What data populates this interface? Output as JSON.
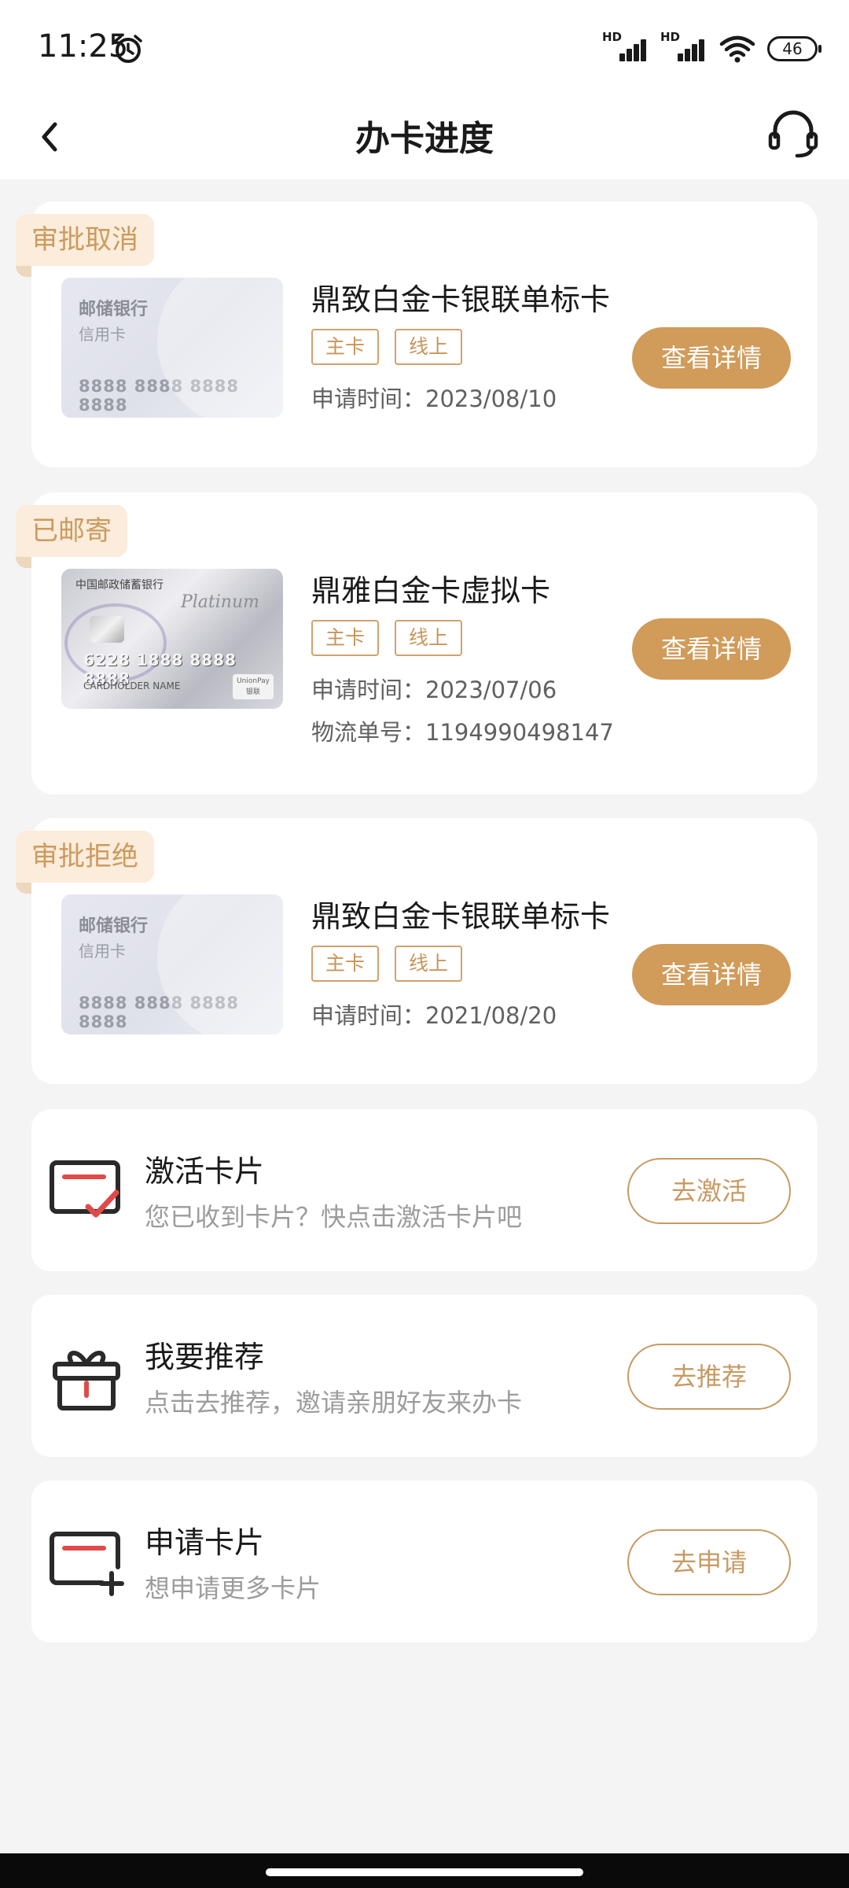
{
  "status_bar": {
    "time": "11:25",
    "battery": "46"
  },
  "nav": {
    "title": "办卡进度"
  },
  "applications": [
    {
      "status": "审批取消",
      "card_image": {
        "bank": "邮储银行",
        "type": "信用卡",
        "number": "8888 8888 8888 8888"
      },
      "name": "鼎致白金卡银联单标卡",
      "tags": [
        "主卡",
        "线上"
      ],
      "apply_time": "申请时间：2023/08/10",
      "button": "查看详情"
    },
    {
      "status": "已邮寄",
      "card_image": {
        "bank": "中国邮政储蓄银行",
        "script": "Platinum",
        "number": "6228 1888 8888 8888",
        "holder": "CARDHOLDER NAME",
        "unionpay": "UnionPay 银联"
      },
      "name": "鼎雅白金卡虚拟卡",
      "tags": [
        "主卡",
        "线上"
      ],
      "apply_time": "申请时间：2023/07/06",
      "tracking": "物流单号：1194990498147",
      "button": "查看详情"
    },
    {
      "status": "审批拒绝",
      "card_image": {
        "bank": "邮储银行",
        "type": "信用卡",
        "number": "8888 8888 8888 8888"
      },
      "name": "鼎致白金卡银联单标卡",
      "tags": [
        "主卡",
        "线上"
      ],
      "apply_time": "申请时间：2021/08/20",
      "button": "查看详情"
    }
  ],
  "actions": [
    {
      "title": "激活卡片",
      "subtitle": "您已收到卡片？快点击激活卡片吧",
      "button": "去激活",
      "icon": "card-check-icon"
    },
    {
      "title": "我要推荐",
      "subtitle": "点击去推荐，邀请亲朋好友来办卡",
      "button": "去推荐",
      "icon": "gift-icon"
    },
    {
      "title": "申请卡片",
      "subtitle": "想申请更多卡片",
      "button": "去申请",
      "icon": "card-plus-icon"
    }
  ],
  "colors": {
    "accent": "#d19b5a",
    "badge_bg": "#fbecdb",
    "badge_text": "#cc9a5e",
    "icon_red": "#e04a4a",
    "icon_dark": "#2a2a2a"
  }
}
